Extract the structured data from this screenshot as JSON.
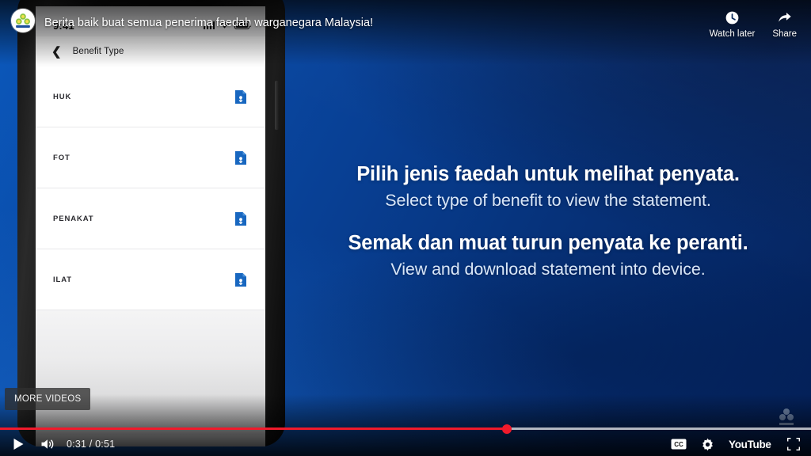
{
  "player": {
    "video_title": "Berita baik buat semua penerima faedah warganegara Malaysia!",
    "channel_avatar_icon": "perkeso-logo-icon",
    "watch_later_label": "Watch later",
    "watch_later_icon": "clock-icon",
    "share_label": "Share",
    "share_icon": "share-arrow-icon",
    "more_videos_label": "MORE VIDEOS",
    "watermark_icon": "perkeso-watermark-icon",
    "accent_color": "#f01a2b",
    "background_gradient_from": "#0b58bb",
    "background_gradient_to": "#04215a"
  },
  "controls": {
    "play_icon": "play-icon",
    "volume_icon": "volume-icon",
    "time_current": "0:31",
    "time_separator": "/",
    "time_total": "0:51",
    "time_display": "0:31 / 0:51",
    "subtitles_icon": "closed-captions-icon",
    "settings_icon": "gear-icon",
    "youtube_label": "YouTube",
    "fullscreen_icon": "fullscreen-icon",
    "progress_percent": 62.5,
    "buffer_percent": 100
  },
  "phone": {
    "status_bar": {
      "time": "9:41",
      "signal_icon": "cellular-signal-icon",
      "wifi_icon": "wifi-icon",
      "battery_icon": "battery-icon"
    },
    "nav": {
      "back_icon": "chevron-left-icon",
      "title": "Benefit Type"
    },
    "benefit_rows": [
      {
        "label": "HUK",
        "action_icon": "document-download-icon"
      },
      {
        "label": "FOT",
        "action_icon": "document-download-icon"
      },
      {
        "label": "PENAKAT",
        "action_icon": "document-download-icon"
      },
      {
        "label": "ILAT",
        "action_icon": "document-download-icon"
      }
    ]
  },
  "overlay": {
    "groups": [
      {
        "ms": "Pilih jenis faedah untuk melihat penyata.",
        "en": "Select type of benefit to view the statement."
      },
      {
        "ms": "Semak dan muat turun penyata ke peranti.",
        "en": "View and download statement into device."
      }
    ]
  }
}
